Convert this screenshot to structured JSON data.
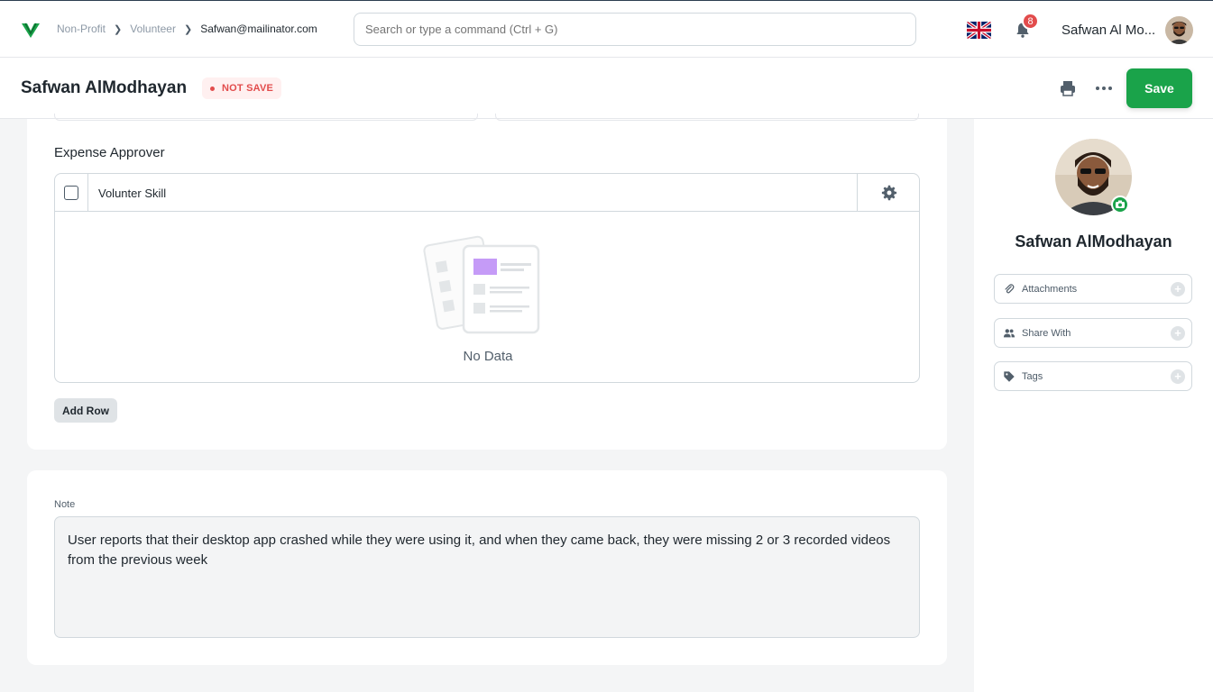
{
  "nav": {
    "breadcrumb": [
      "Non-Profit",
      "Volunteer",
      "Safwan@mailinator.com"
    ],
    "search_placeholder": "Search or type a command (Ctrl + G)",
    "notification_count": "8",
    "user_name": "Safwan Al Mo..."
  },
  "header": {
    "title": "Safwan AlModhayan",
    "status": "NOT SAVE",
    "save_label": "Save"
  },
  "form": {
    "section_label": "Expense Approver",
    "grid": {
      "columns": [
        "Volunter Skill"
      ],
      "empty_text": "No Data",
      "add_row_label": "Add Row"
    },
    "note": {
      "label": "Note",
      "value": "User reports that their desktop app crashed while they were using it, and when they came back, they were missing 2 or 3 recorded videos from the previous week"
    }
  },
  "sidebar": {
    "name": "Safwan AlModhayan",
    "items": [
      {
        "label": "Attachments",
        "icon": "paperclip-icon"
      },
      {
        "label": "Share With",
        "icon": "users-icon"
      },
      {
        "label": "Tags",
        "icon": "tag-icon"
      }
    ]
  },
  "colors": {
    "primary": "#1aa34a",
    "danger": "#e24c4c"
  }
}
